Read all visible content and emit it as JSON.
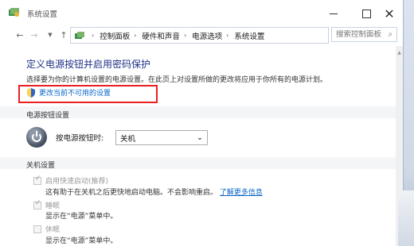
{
  "window": {
    "title": "系统设置",
    "min_label": "",
    "max_label": "",
    "close_label": "✕"
  },
  "address": {
    "breadcrumbs": [
      "控制面板",
      "硬件和声音",
      "电源选项",
      "系统设置"
    ],
    "search_placeholder": "搜索控制面板"
  },
  "page": {
    "title": "定义电源按钮并启用密码保护",
    "description": "选择要为你的计算机设置的电源设置。在此页上对设置所做的更改将应用于你所有的电源计划。",
    "change_link": "更改当前不可用的设置"
  },
  "power_button": {
    "section_title": "电源按钮设置",
    "label": "按电源按钮时:",
    "value": "关机"
  },
  "shutdown": {
    "section_title": "关机设置",
    "fast_startup": {
      "label": "启用快速启动(推荐)",
      "checked": true,
      "description": "这有助于在关机之后更快地启动电脑。不会影响重启。",
      "link": "了解更多信息"
    },
    "sleep": {
      "label": "睡眠",
      "checked": true,
      "description": "显示在“电源”菜单中。"
    },
    "hibernate": {
      "label": "休眠",
      "checked": false,
      "description": "显示在“电源”菜单中。"
    }
  },
  "colors": {
    "link": "#0b66c9",
    "title": "#1e3287",
    "highlight": "#ea1f22"
  }
}
